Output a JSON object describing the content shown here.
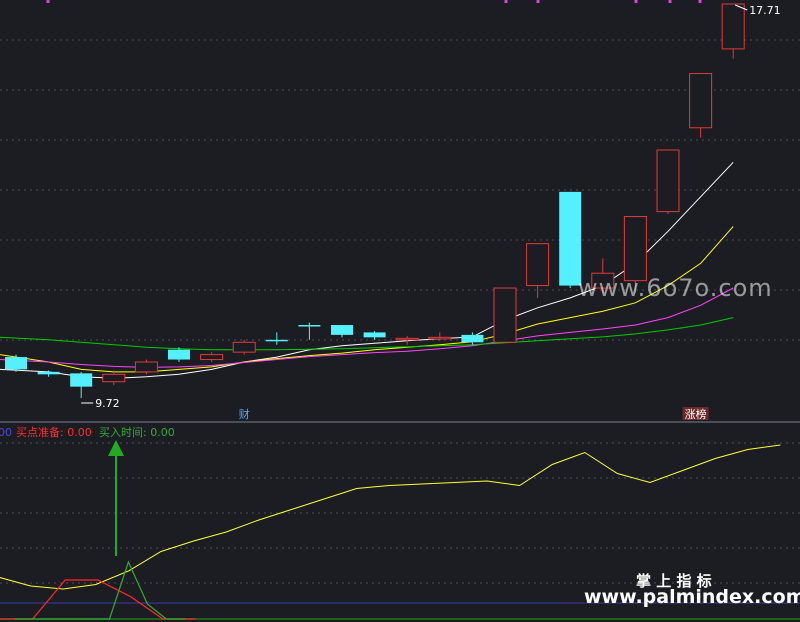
{
  "chart_data": [
    {
      "type": "candlestick",
      "price_labels": {
        "high": "17.71",
        "low": "9.72"
      },
      "candles": [
        {
          "o": 10.55,
          "c": 10.3,
          "h": 10.6,
          "l": 10.25
        },
        {
          "o": 10.25,
          "c": 10.2,
          "h": 10.28,
          "l": 10.15
        },
        {
          "o": 10.22,
          "c": 9.95,
          "h": 10.25,
          "l": 9.72
        },
        {
          "o": 10.05,
          "c": 10.2,
          "h": 10.28,
          "l": 9.98
        },
        {
          "o": 10.25,
          "c": 10.45,
          "h": 10.5,
          "l": 10.2
        },
        {
          "o": 10.7,
          "c": 10.5,
          "h": 10.75,
          "l": 10.45
        },
        {
          "o": 10.5,
          "c": 10.6,
          "h": 10.65,
          "l": 10.45
        },
        {
          "o": 10.65,
          "c": 10.85,
          "h": 10.9,
          "l": 10.6
        },
        {
          "o": 10.9,
          "c": 10.88,
          "h": 11.05,
          "l": 10.8
        },
        {
          "o": 11.2,
          "c": 11.18,
          "h": 11.25,
          "l": 10.9
        },
        {
          "o": 11.2,
          "c": 11.0,
          "h": 11.2,
          "l": 10.95
        },
        {
          "o": 11.05,
          "c": 10.95,
          "h": 11.08,
          "l": 10.9
        },
        {
          "o": 10.9,
          "c": 10.93,
          "h": 10.98,
          "l": 10.8
        },
        {
          "o": 10.92,
          "c": 10.95,
          "h": 11.05,
          "l": 10.88
        },
        {
          "o": 11.0,
          "c": 10.85,
          "h": 11.05,
          "l": 10.8
        },
        {
          "o": 10.85,
          "c": 11.95,
          "h": 11.95,
          "l": 10.85
        },
        {
          "o": 12.0,
          "c": 12.85,
          "h": 12.85,
          "l": 11.75
        },
        {
          "o": 13.9,
          "c": 12.0,
          "h": 13.9,
          "l": 11.95
        },
        {
          "o": 11.95,
          "c": 12.25,
          "h": 12.55,
          "l": 11.85
        },
        {
          "o": 12.1,
          "c": 13.4,
          "h": 13.4,
          "l": 11.85
        },
        {
          "o": 13.5,
          "c": 14.75,
          "h": 14.75,
          "l": 13.45
        },
        {
          "o": 15.2,
          "c": 16.3,
          "h": 16.3,
          "l": 15.0
        },
        {
          "o": 16.8,
          "c": 17.71,
          "h": 17.71,
          "l": 16.6
        }
      ],
      "moving_averages": [
        {
          "color": "#ffffff",
          "values": [
            10.3,
            10.25,
            10.15,
            10.12,
            10.15,
            10.2,
            10.3,
            10.45,
            10.55,
            10.7,
            10.78,
            10.83,
            10.88,
            10.92,
            10.96,
            11.3,
            11.55,
            11.75,
            12.0,
            12.45,
            13.1,
            13.8,
            14.5
          ]
        },
        {
          "color": "#ffff00",
          "values": [
            10.6,
            10.45,
            10.3,
            10.25,
            10.25,
            10.3,
            10.35,
            10.45,
            10.52,
            10.58,
            10.63,
            10.7,
            10.75,
            10.8,
            10.86,
            11.02,
            11.22,
            11.35,
            11.48,
            11.65,
            12.0,
            12.45,
            13.2
          ]
        },
        {
          "color": "#ff44ff",
          "values": [
            10.5,
            10.45,
            10.4,
            10.36,
            10.34,
            10.35,
            10.38,
            10.44,
            10.5,
            10.56,
            10.6,
            10.64,
            10.67,
            10.72,
            10.78,
            10.88,
            10.98,
            11.05,
            11.12,
            11.2,
            11.35,
            11.6,
            11.95
          ]
        },
        {
          "color": "#00cc00",
          "values": [
            10.95,
            10.9,
            10.85,
            10.8,
            10.75,
            10.72,
            10.7,
            10.7,
            10.7,
            10.71,
            10.72,
            10.74,
            10.76,
            10.78,
            10.8,
            10.84,
            10.88,
            10.92,
            10.96,
            11.02,
            11.1,
            11.2,
            11.35
          ]
        }
      ],
      "markers": [
        {
          "index": 7,
          "text": "财"
        },
        {
          "index": 21,
          "text": "涨榜"
        }
      ]
    },
    {
      "type": "line",
      "legend": [
        {
          "text": "00",
          "color": "#4a4ad8"
        },
        {
          "text": "买点准备: 0.00",
          "color": "#ff2a2a"
        },
        {
          "text": "买入时间: 0.00",
          "color": "#33aa33"
        }
      ],
      "series": [
        {
          "color": "#ffff33",
          "values": [
            28,
            22,
            20,
            23,
            32,
            45,
            52,
            58,
            66,
            73,
            80,
            87,
            89,
            90,
            91,
            92,
            89,
            103,
            111,
            97,
            91,
            99,
            107,
            113,
            116
          ]
        },
        {
          "color": "#ff2a2a",
          "values": [
            0,
            0,
            26,
            26,
            15,
            0,
            0
          ]
        },
        {
          "color": "#33aa33",
          "values": [
            0,
            0,
            0,
            0,
            0,
            0,
            38,
            10,
            0,
            0
          ]
        }
      ]
    }
  ],
  "watermarks": {
    "top": "www.6o7o.com",
    "brand_cn": "掌 上 指 标",
    "brand_url": "www.palmindex.com"
  }
}
